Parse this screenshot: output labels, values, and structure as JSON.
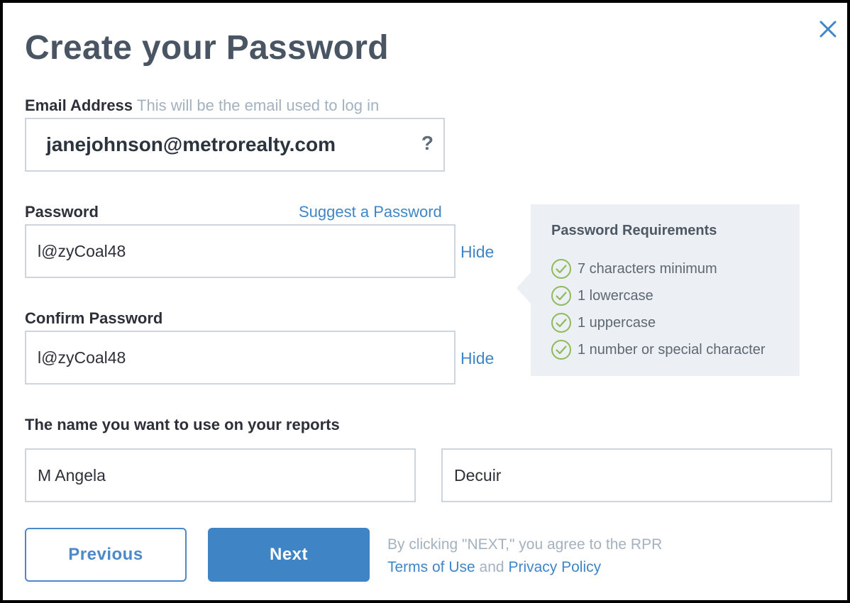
{
  "modal": {
    "title": "Create your Password",
    "close_icon": "close-icon"
  },
  "email": {
    "label": "Email Address",
    "hint": "This will be the email used to log in",
    "value": "janejohnson@metrorealty.com",
    "help_text": "?"
  },
  "password": {
    "label": "Password",
    "suggest_link": "Suggest a Password",
    "value": "l@zyCoal48",
    "hide_link": "Hide"
  },
  "confirm_password": {
    "label": "Confirm Password",
    "value": "l@zyCoal48",
    "hide_link": "Hide"
  },
  "requirements": {
    "title": "Password Requirements",
    "items": [
      {
        "text": "7 characters minimum",
        "met": true
      },
      {
        "text": "1 lowercase",
        "met": true
      },
      {
        "text": "1 uppercase",
        "met": true
      },
      {
        "text": "1 number or special character",
        "met": true
      }
    ],
    "check_color": "#8dbb5c"
  },
  "report_name": {
    "label": "The name you want to use on your reports",
    "first_value": "M Angela",
    "last_value": "Decuir"
  },
  "buttons": {
    "previous": "Previous",
    "next": "Next"
  },
  "agreement": {
    "text": "By clicking \"NEXT,\" you agree to the RPR",
    "terms_link": "Terms of Use",
    "and": "and",
    "privacy_link": "Privacy Policy"
  },
  "colors": {
    "accent": "#3f84c4",
    "title": "#4a5563",
    "hint": "#a4b1be",
    "panel_bg": "#eceff3"
  }
}
